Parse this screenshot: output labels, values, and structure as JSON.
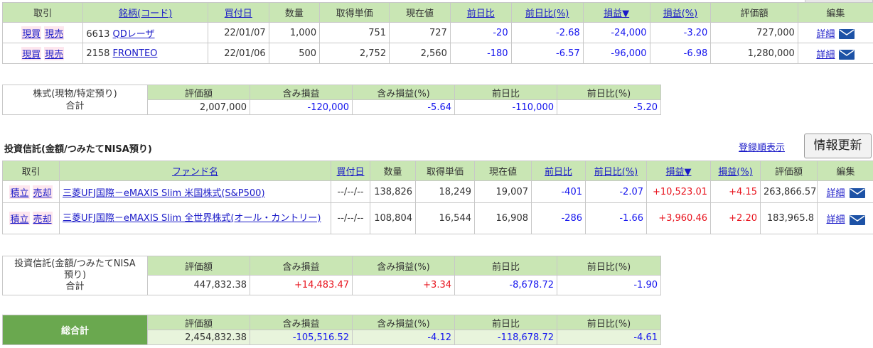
{
  "stocks": {
    "headers": {
      "trade": "取引",
      "name": "銘柄(コード)",
      "buy_date": "買付日",
      "qty": "数量",
      "cost": "取得単価",
      "price": "現在値",
      "change": "前日比",
      "change_pct": "前日比(%)",
      "pl": "損益▼",
      "pl_pct": "損益(%)",
      "value": "評価額",
      "edit": "編集"
    },
    "rows": [
      {
        "buy": "現買",
        "sell": "現売",
        "code": "6613",
        "name": "QDレーザ",
        "buy_date": "22/01/07",
        "qty": "1,000",
        "cost": "751",
        "price": "727",
        "change": "-20",
        "change_pct": "-2.68",
        "pl": "-24,000",
        "pl_pct": "-3.20",
        "value": "727,000",
        "detail": "詳細"
      },
      {
        "buy": "現買",
        "sell": "現売",
        "code": "2158",
        "name": "FRONTEO",
        "buy_date": "22/01/06",
        "qty": "500",
        "cost": "2,752",
        "price": "2,560",
        "change": "-180",
        "change_pct": "-6.57",
        "pl": "-96,000",
        "pl_pct": "-6.98",
        "value": "1,280,000",
        "detail": "詳細"
      }
    ]
  },
  "stock_summary": {
    "label_line1": "株式(現物/特定預り)",
    "label_line2": "合計",
    "headers": {
      "value": "評価額",
      "unrealized": "含み損益",
      "unrealized_pct": "含み損益(%)",
      "change": "前日比",
      "change_pct": "前日比(%)"
    },
    "values": {
      "value": "2,007,000",
      "unrealized": "-120,000",
      "unrealized_pct": "-5.64",
      "change": "-110,000",
      "change_pct": "-5.20"
    }
  },
  "funds_section": {
    "title": "投資信託(金額/つみたてNISA預り)",
    "order_link": "登録順表示",
    "refresh_button": "情報更新"
  },
  "funds": {
    "headers": {
      "trade": "取引",
      "name": "ファンド名",
      "buy_date": "買付日",
      "qty": "数量",
      "cost": "取得単価",
      "price": "現在値",
      "change": "前日比",
      "change_pct": "前日比(%)",
      "pl": "損益▼",
      "pl_pct": "損益(%)",
      "value": "評価額",
      "edit": "編集"
    },
    "rows": [
      {
        "buy": "積立",
        "sell": "売却",
        "name": "三菱UFJ国際－eMAXIS Slim 米国株式(S&P500)",
        "buy_date": "--/--/--",
        "qty": "138,826",
        "cost": "18,249",
        "price": "19,007",
        "change": "-401",
        "change_pct": "-2.07",
        "pl": "+10,523.01",
        "pl_pct": "+4.15",
        "value": "263,866.57",
        "detail": "詳細"
      },
      {
        "buy": "積立",
        "sell": "売却",
        "name": "三菱UFJ国際－eMAXIS Slim 全世界株式(オール・カントリー)",
        "buy_date": "--/--/--",
        "qty": "108,804",
        "cost": "16,544",
        "price": "16,908",
        "change": "-286",
        "change_pct": "-1.66",
        "pl": "+3,960.46",
        "pl_pct": "+2.20",
        "value": "183,965.8",
        "detail": "詳細"
      }
    ]
  },
  "fund_summary": {
    "label_line1": "投資信託(金額/つみたてNISA",
    "label_line2": "預り)",
    "label_line3": "合計",
    "headers": {
      "value": "評価額",
      "unrealized": "含み損益",
      "unrealized_pct": "含み損益(%)",
      "change": "前日比",
      "change_pct": "前日比(%)"
    },
    "values": {
      "value": "447,832.38",
      "unrealized": "+14,483.47",
      "unrealized_pct": "+3.34",
      "change": "-8,678.72",
      "change_pct": "-1.90"
    }
  },
  "grand_total": {
    "label": "総合計",
    "headers": {
      "value": "評価額",
      "unrealized": "含み損益",
      "unrealized_pct": "含み損益(%)",
      "change": "前日比",
      "change_pct": "前日比(%)"
    },
    "values": {
      "value": "2,454,832.38",
      "unrealized": "-105,516.52",
      "unrealized_pct": "-4.12",
      "change": "-118,678.72",
      "change_pct": "-4.61"
    }
  },
  "colors": {
    "header_green": "#c9e6b4",
    "total_green": "#6aa84f",
    "negative": "#1616ee",
    "positive": "#e8141e",
    "link": "#1a1ac8"
  },
  "icons": {
    "mail": "mail-icon"
  }
}
